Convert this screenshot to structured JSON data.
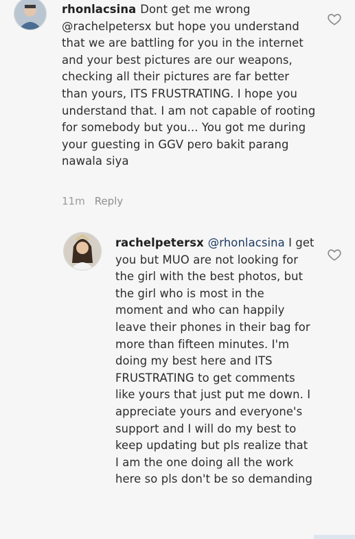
{
  "comments": [
    {
      "username": "rhonlacsina",
      "mention": "",
      "body": "Dont get me wrong @rachelpetersx but hope you understand that we are battling for you in the internet and your best pictures are our weapons, checking all their pictures are far better than yours, ITS FRUSTRATING. I hope you understand that. I am not capable of rooting for somebody but you... You got me during your guesting in GGV pero bakit parang nawala siya",
      "time": "11m",
      "reply_label": "Reply",
      "avatar_icon": "user-avatar"
    },
    {
      "username": "rachelpetersx",
      "mention": "@rhonlacsina",
      "body": "I get you but MUO are not looking for the girl with the best photos, but the girl who is most in the moment and who can happily leave their phones in their bag for more than fifteen minutes. I'm doing my best here and ITS FRUSTRATING to get comments like yours that just put me down. I appreciate yours and everyone's support and I will do my best to keep updating but pls realize that I am the one doing all the work here so pls don't be so demanding",
      "avatar_icon": "user-avatar"
    }
  ],
  "colors": {
    "text": "#2c2c2c",
    "meta": "#9a9a9a",
    "background": "#f6f6f6"
  },
  "icons": {
    "like": "heart-outline-icon"
  }
}
